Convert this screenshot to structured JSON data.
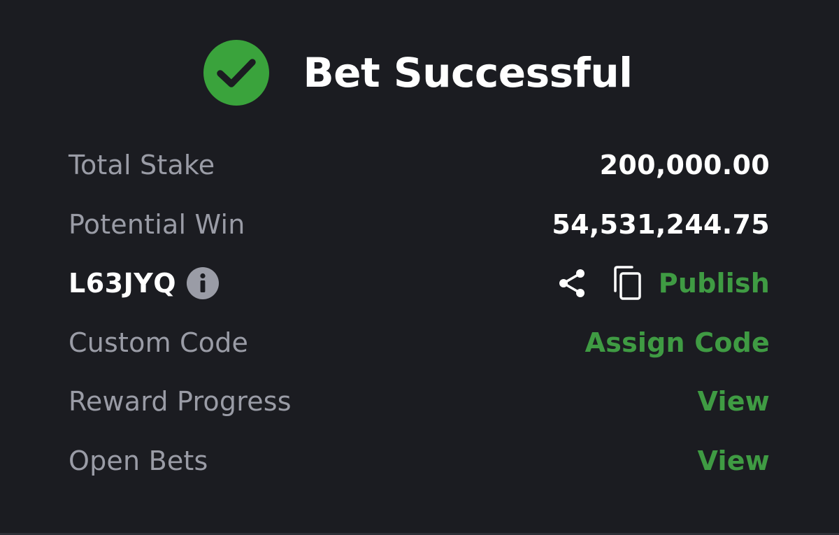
{
  "header": {
    "title": "Bet Successful",
    "icon": "check-circle-icon",
    "icon_color": "#3aa33c"
  },
  "summary": {
    "total_stake_label": "Total Stake",
    "total_stake_value": "200,000.00",
    "potential_win_label": "Potential Win",
    "potential_win_value": "54,531,244.75"
  },
  "booking": {
    "code": "L63JYQ",
    "info_icon": "info-icon",
    "share_icon": "share-icon",
    "copy_icon": "copy-icon",
    "publish_label": "Publish"
  },
  "links": {
    "custom_code_label": "Custom Code",
    "assign_code_label": "Assign Code",
    "reward_progress_label": "Reward Progress",
    "reward_view_label": "View",
    "open_bets_label": "Open Bets",
    "open_bets_view_label": "View"
  },
  "colors": {
    "background": "#1b1c21",
    "accent": "#3f9b43",
    "label": "#9a9ca6",
    "value": "#ffffff"
  }
}
